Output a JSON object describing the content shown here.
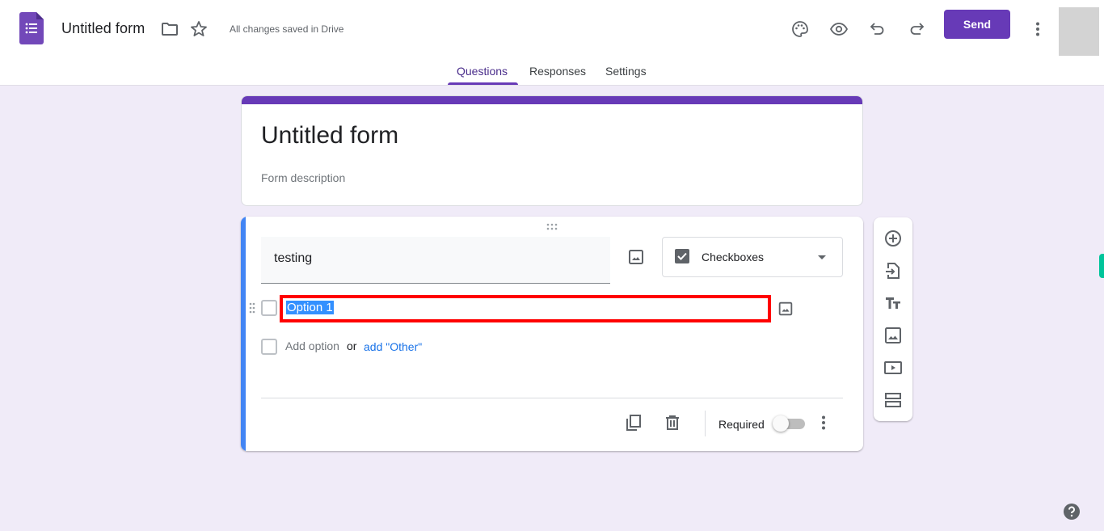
{
  "header": {
    "app_icon": "google-forms-logo",
    "doc_title": "Untitled form",
    "save_status": "All changes saved in Drive",
    "icons": [
      "folder-icon",
      "star-icon",
      "palette-icon",
      "eye-icon",
      "undo-icon",
      "redo-icon",
      "more-vert-icon"
    ],
    "send_label": "Send"
  },
  "tabs": [
    {
      "label": "Questions",
      "active": true
    },
    {
      "label": "Responses",
      "active": false
    },
    {
      "label": "Settings",
      "active": false
    }
  ],
  "form": {
    "title": "Untitled form",
    "description_placeholder": "Form description"
  },
  "question": {
    "title": "testing",
    "type": "Checkboxes",
    "options": [
      {
        "label": "Option 1",
        "selected_text": true
      }
    ],
    "add_option_label": "Add option",
    "or_label": "or",
    "add_other_label": "add \"Other\"",
    "required_label": "Required",
    "required": false
  },
  "side_toolbar": [
    {
      "icon": "add-question-icon"
    },
    {
      "icon": "import-questions-icon"
    },
    {
      "icon": "add-title-icon"
    },
    {
      "icon": "add-image-icon"
    },
    {
      "icon": "add-video-icon"
    },
    {
      "icon": "add-section-icon"
    }
  ],
  "colors": {
    "brand": "#673ab7",
    "background": "#f0ebf8",
    "question_accent": "#4285f4",
    "highlight_box": "#ff0000",
    "selection": "#3390ff",
    "link": "#1a73e8"
  }
}
